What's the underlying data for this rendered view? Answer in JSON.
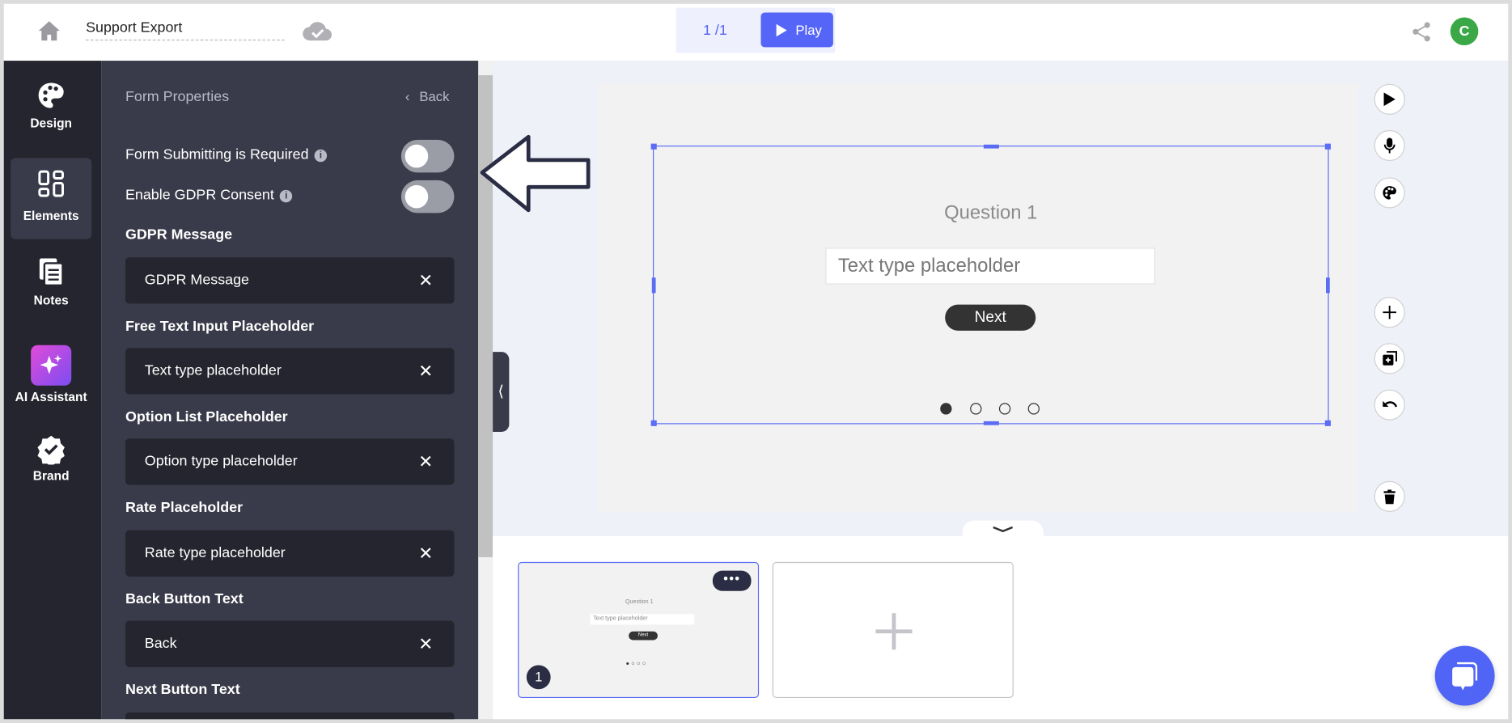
{
  "header": {
    "doc_title": "Support Export",
    "page_counter": "1 /1",
    "play_label": "Play",
    "avatar_initial": "C",
    "avatar_color": "#3aa847",
    "accent": "#5565f8"
  },
  "rail": {
    "items": [
      {
        "label": "Design",
        "icon": "palette-icon"
      },
      {
        "label": "Elements",
        "icon": "elements-icon",
        "selected": true
      },
      {
        "label": "Notes",
        "icon": "notes-icon"
      },
      {
        "label": "AI Assistant",
        "icon": "sparkles-icon"
      },
      {
        "label": "Brand",
        "icon": "badge-check-icon"
      }
    ]
  },
  "panel": {
    "title": "Form Properties",
    "back_label": "Back",
    "toggles": [
      {
        "label": "Form Submitting is Required",
        "on": false
      },
      {
        "label": "Enable GDPR Consent",
        "on": false
      }
    ],
    "fields": [
      {
        "label": "GDPR Message",
        "value": "GDPR Message"
      },
      {
        "label": "Free Text Input Placeholder",
        "value": "Text type placeholder"
      },
      {
        "label": "Option List Placeholder",
        "value": "Option type placeholder"
      },
      {
        "label": "Rate Placeholder",
        "value": "Rate type placeholder"
      },
      {
        "label": "Back Button Text",
        "value": "Back"
      },
      {
        "label": "Next Button Text",
        "value": ""
      }
    ]
  },
  "slide": {
    "question": "Question 1",
    "input_placeholder": "Text type placeholder",
    "next_label": "Next",
    "dots": 4,
    "active_dot": 1
  },
  "thumbnails": [
    {
      "number": "1",
      "question": "Question 1",
      "input_placeholder": "Text type placeholder",
      "next_label": "Next"
    }
  ]
}
